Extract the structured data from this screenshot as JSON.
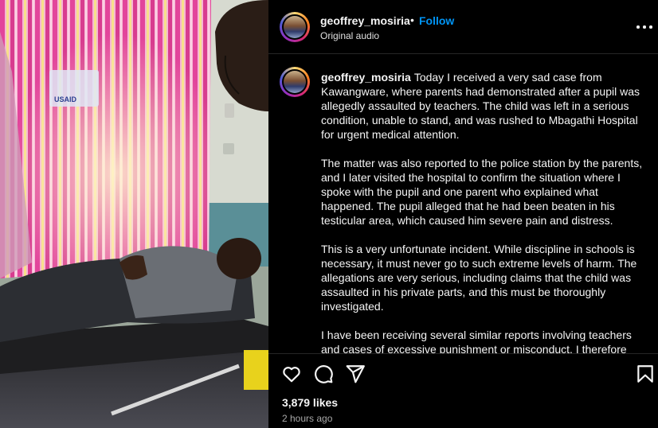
{
  "post": {
    "username": "geoffrey_mosiria",
    "separator": "•",
    "follow_label": "Follow",
    "audio": "Original audio"
  },
  "caption": {
    "username": "geoffrey_mosiria",
    "paragraphs": [
      "Today I received a very sad case from Kawangware, where parents had demonstrated after a pupil was allegedly assaulted by teachers. The child was left in a serious condition, unable to stand, and was rushed to Mbagathi Hospital for urgent medical attention.",
      "The matter was also reported to the police station by the parents, and I later visited the hospital to confirm the situation where I spoke with the pupil and one parent who explained what happened. The pupil alleged that he had been beaten in his testicular area, which caused him severe pain and distress.",
      "This is a very unfortunate incident. While discipline in schools is necessary, it must never go to such extreme levels of harm. The allegations are very serious, including claims that the child was assaulted in his private parts, and this must be thoroughly investigated.",
      "I have been receiving several similar reports involving teachers and cases of excessive punishment or misconduct. I therefore"
    ]
  },
  "footer": {
    "likes": "3,879 likes",
    "time": "2 hours ago"
  },
  "photo": {
    "logo_text": "USAID"
  },
  "icons": {
    "like": "heart-icon",
    "comment": "comment-bubble-icon",
    "share": "paper-plane-icon",
    "save": "bookmark-icon",
    "more": "more-options-icon"
  },
  "colors": {
    "background": "#000000",
    "text": "#f5f5f5",
    "follow": "#0095f6",
    "muted": "#a8a8a8"
  }
}
